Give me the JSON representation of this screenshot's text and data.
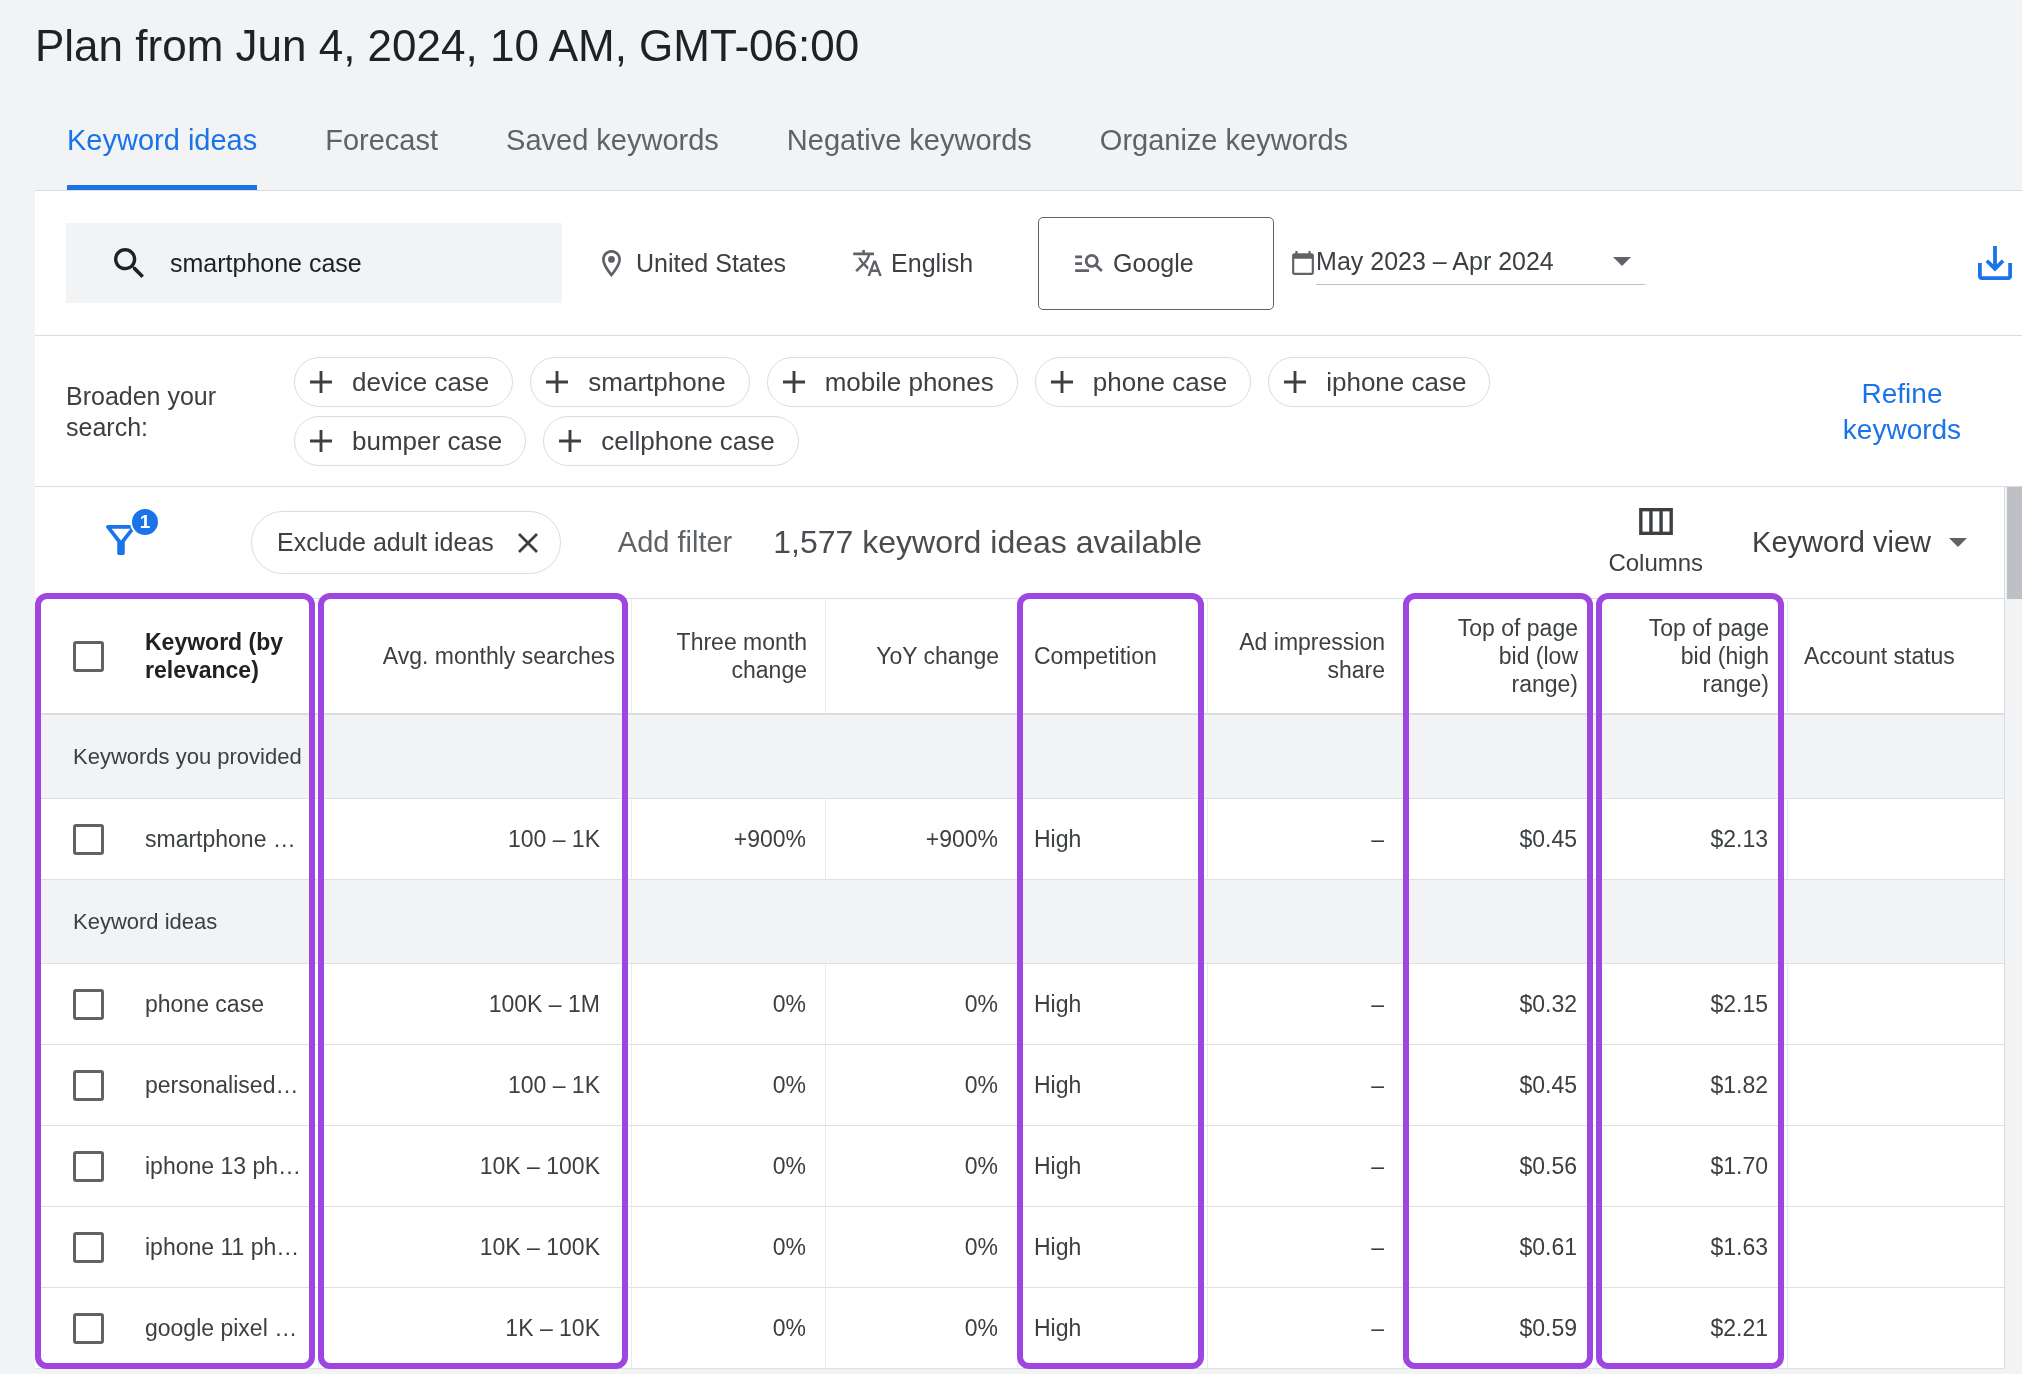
{
  "title": "Plan from Jun 4, 2024, 10 AM, GMT-06:00",
  "tabs": [
    {
      "label": "Keyword ideas",
      "selected": true
    },
    {
      "label": "Forecast",
      "selected": false
    },
    {
      "label": "Saved keywords",
      "selected": false
    },
    {
      "label": "Negative keywords",
      "selected": false
    },
    {
      "label": "Organize keywords",
      "selected": false
    }
  ],
  "search_bar": {
    "query": "smartphone case",
    "location": "United States",
    "language": "English",
    "network": "Google",
    "date_range": "May 2023 – Apr 2024"
  },
  "broaden_search": {
    "label": "Broaden your search:",
    "suggestions": [
      "device case",
      "smartphone",
      "mobile phones",
      "phone case",
      "iphone case",
      "bumper case",
      "cellphone case"
    ],
    "refine_link": "Refine keywords"
  },
  "filter_bar": {
    "active_filter_count": "1",
    "filters": [
      "Exclude adult ideas"
    ],
    "add_filter": "Add filter",
    "result_count": "1,577 keyword ideas available",
    "columns_button": "Columns",
    "view_menu": "Keyword view"
  },
  "table": {
    "select_all_checked": false,
    "columns": [
      {
        "label": "Keyword (by relevance)",
        "kind": "keyword",
        "highlighted": true
      },
      {
        "label": "Avg. monthly searches",
        "kind": "number",
        "highlighted": true
      },
      {
        "label": "Three month change",
        "kind": "number",
        "highlighted": false
      },
      {
        "label": "YoY change",
        "kind": "number",
        "highlighted": false
      },
      {
        "label": "Competition",
        "kind": "text",
        "highlighted": true
      },
      {
        "label": "Ad impression share",
        "kind": "number",
        "highlighted": false
      },
      {
        "label": "Top of page bid (low range)",
        "kind": "number",
        "highlighted": true
      },
      {
        "label": "Top of page bid (high range)",
        "kind": "number",
        "highlighted": true
      },
      {
        "label": "Account status",
        "kind": "text",
        "highlighted": false
      }
    ],
    "groups": [
      {
        "label": "Keywords you provided",
        "rows": [
          {
            "checked": false,
            "cells": [
              "smartphone …",
              "100 – 1K",
              "+900%",
              "+900%",
              "High",
              "–",
              "$0.45",
              "$2.13"
            ]
          }
        ]
      },
      {
        "label": "Keyword ideas",
        "rows": [
          {
            "checked": false,
            "cells": [
              "phone case",
              "100K – 1M",
              "0%",
              "0%",
              "High",
              "–",
              "$0.32",
              "$2.15"
            ]
          },
          {
            "checked": false,
            "cells": [
              "personalised…",
              "100 – 1K",
              "0%",
              "0%",
              "High",
              "–",
              "$0.45",
              "$1.82"
            ]
          },
          {
            "checked": false,
            "cells": [
              "iphone 13 ph…",
              "10K – 100K",
              "0%",
              "0%",
              "High",
              "–",
              "$0.56",
              "$1.70"
            ]
          },
          {
            "checked": false,
            "cells": [
              "iphone 11 ph…",
              "10K – 100K",
              "0%",
              "0%",
              "High",
              "–",
              "$0.61",
              "$1.63"
            ]
          },
          {
            "checked": false,
            "cells": [
              "google pixel …",
              "1K – 10K",
              "0%",
              "0%",
              "High",
              "–",
              "$0.59",
              "$2.21"
            ]
          }
        ]
      }
    ]
  }
}
